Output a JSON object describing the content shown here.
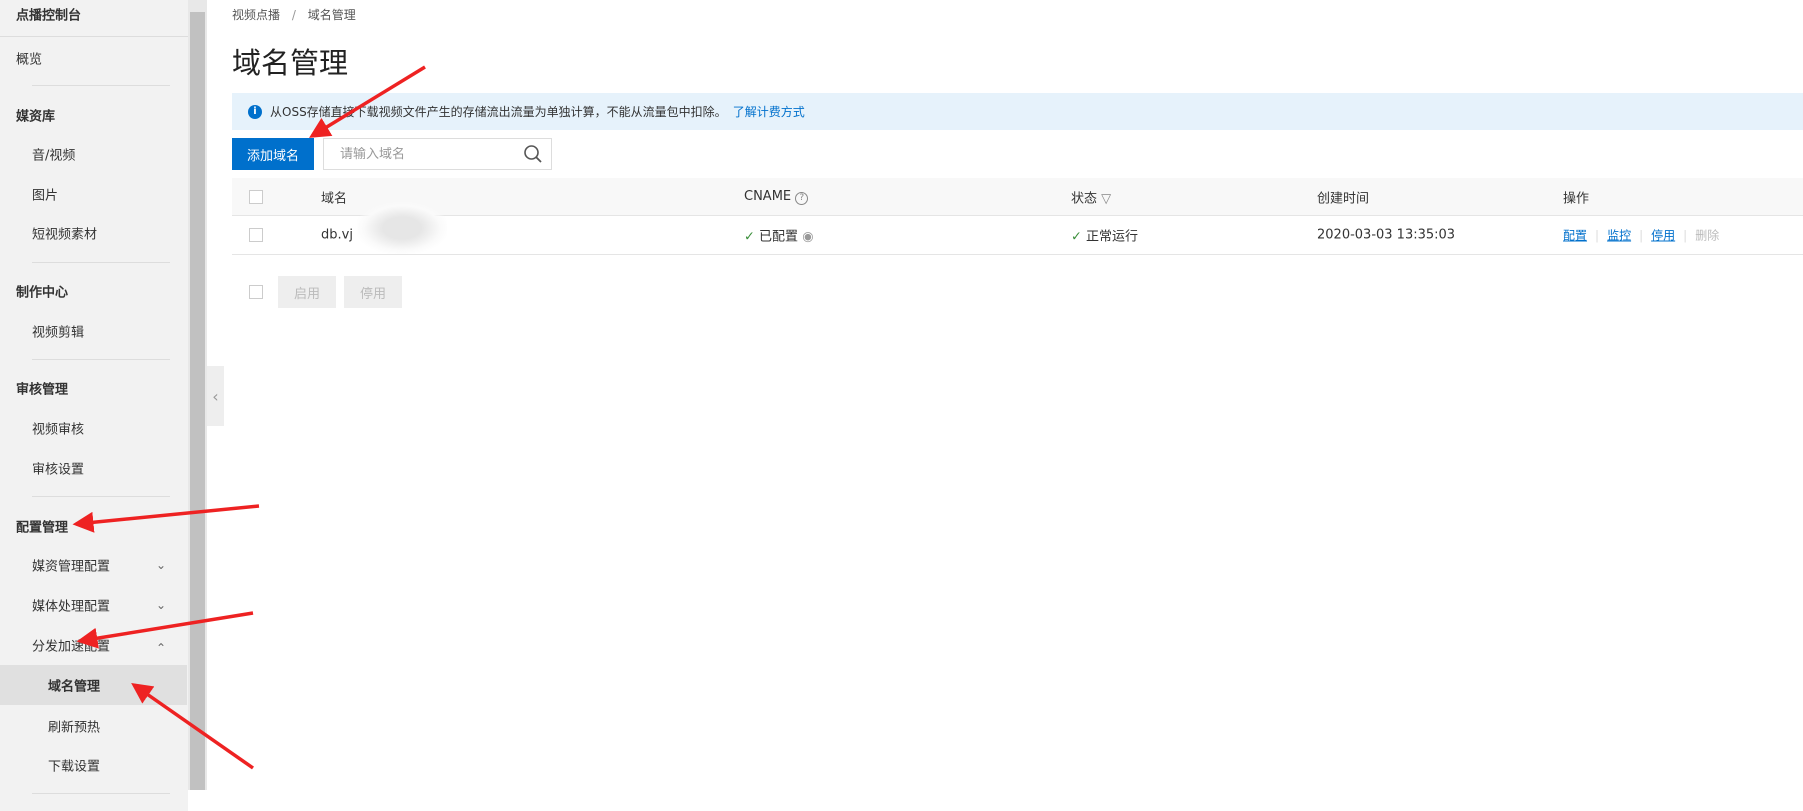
{
  "sidebar": {
    "title": "点播控制台",
    "overview": "概览",
    "media_library": "媒资库",
    "audio_video": "音/视频",
    "images": "图片",
    "short_video": "短视频素材",
    "production": "制作中心",
    "video_edit": "视频剪辑",
    "review": "审核管理",
    "video_review": "视频审核",
    "review_settings": "审核设置",
    "config": "配置管理",
    "media_config": "媒资管理配置",
    "processing_config": "媒体处理配置",
    "cdn_config": "分发加速配置",
    "domain_mgmt": "域名管理",
    "refresh": "刷新预热",
    "download": "下载设置"
  },
  "breadcrumb": {
    "root": "视频点播",
    "sep": "/",
    "current": "域名管理"
  },
  "page_title": "域名管理",
  "info": {
    "text": "从OSS存储直接下载视频文件产生的存储流出流量为单独计算，不能从流量包中扣除。",
    "link": "了解计费方式"
  },
  "toolbar": {
    "add_label": "添加域名",
    "search_placeholder": "请输入域名"
  },
  "table": {
    "headers": {
      "domain": "域名",
      "cname": "CNAME",
      "status": "状态",
      "created": "创建时间",
      "actions": "操作"
    },
    "rows": [
      {
        "domain": "db.vj",
        "cname": "已配置",
        "status": "正常运行",
        "created": "2020-03-03 13:35:03",
        "actions": {
          "config": "配置",
          "monitor": "监控",
          "disable": "停用",
          "delete": "删除"
        }
      }
    ]
  },
  "bulk": {
    "enable": "启用",
    "disable": "停用"
  },
  "colors": {
    "primary": "#0070cc",
    "success": "#3a8f3a",
    "annotation": "#ee2222"
  }
}
